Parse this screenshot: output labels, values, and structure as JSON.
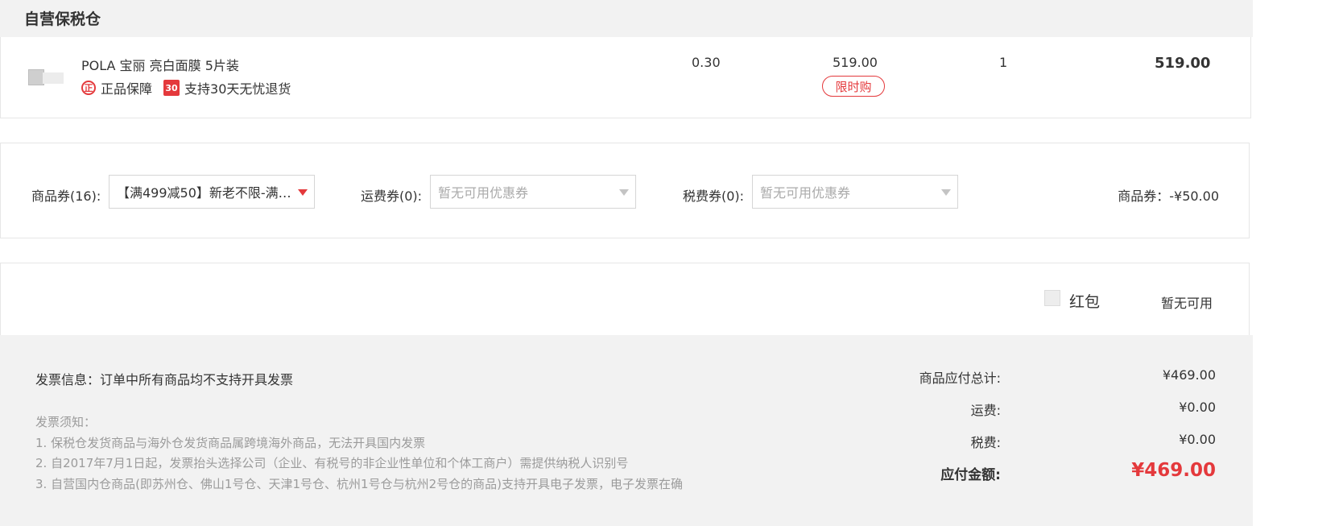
{
  "section": {
    "title": "自营保税仓"
  },
  "product": {
    "name": "POLA 宝丽 亮白面膜 5片装",
    "guarantee_genuine_icon": "正",
    "guarantee_genuine": "正品保障",
    "guarantee_return_icon": "30",
    "guarantee_return": "支持30天无忧退货",
    "weight": "0.30",
    "price": "519.00",
    "badge": "限时购",
    "quantity": "1",
    "subtotal": "519.00"
  },
  "coupons": {
    "goods_label": "商品券(16):",
    "goods_selected": "【满499减50】新老不限-满…",
    "shipping_label": "运费券(0):",
    "shipping_placeholder": "暂无可用优惠券",
    "tax_label": "税费券(0):",
    "tax_placeholder": "暂无可用优惠券",
    "discount_text": "商品券：-¥50.00"
  },
  "red_packet": {
    "label": "红包",
    "status": "暂无可用"
  },
  "invoice": {
    "info": "发票信息：订单中所有商品均不支持开具发票",
    "notes_title": "发票须知：",
    "notes": [
      "1. 保税仓发货商品与海外仓发货商品属跨境海外商品，无法开具国内发票",
      "2. 自2017年7月1日起，发票抬头选择公司（企业、有税号的非企业性单位和个体工商户）需提供纳税人识别号",
      "3. 自营国内仓商品(即苏州仓、佛山1号仓、天津1号仓、杭州1号仓与杭州2号仓的商品)支持开具电子发票，电子发票在确"
    ]
  },
  "summary": {
    "goods_total_label": "商品应付总计:",
    "goods_total": "¥469.00",
    "shipping_label": "运费:",
    "shipping": "¥0.00",
    "tax_label": "税费:",
    "tax": "¥0.00",
    "payable_label": "应付金额:",
    "payable": "¥469.00"
  },
  "colors": {
    "accent": "#e4393c",
    "panel_bg": "#f2f2f2",
    "border": "#e6e6e6"
  }
}
